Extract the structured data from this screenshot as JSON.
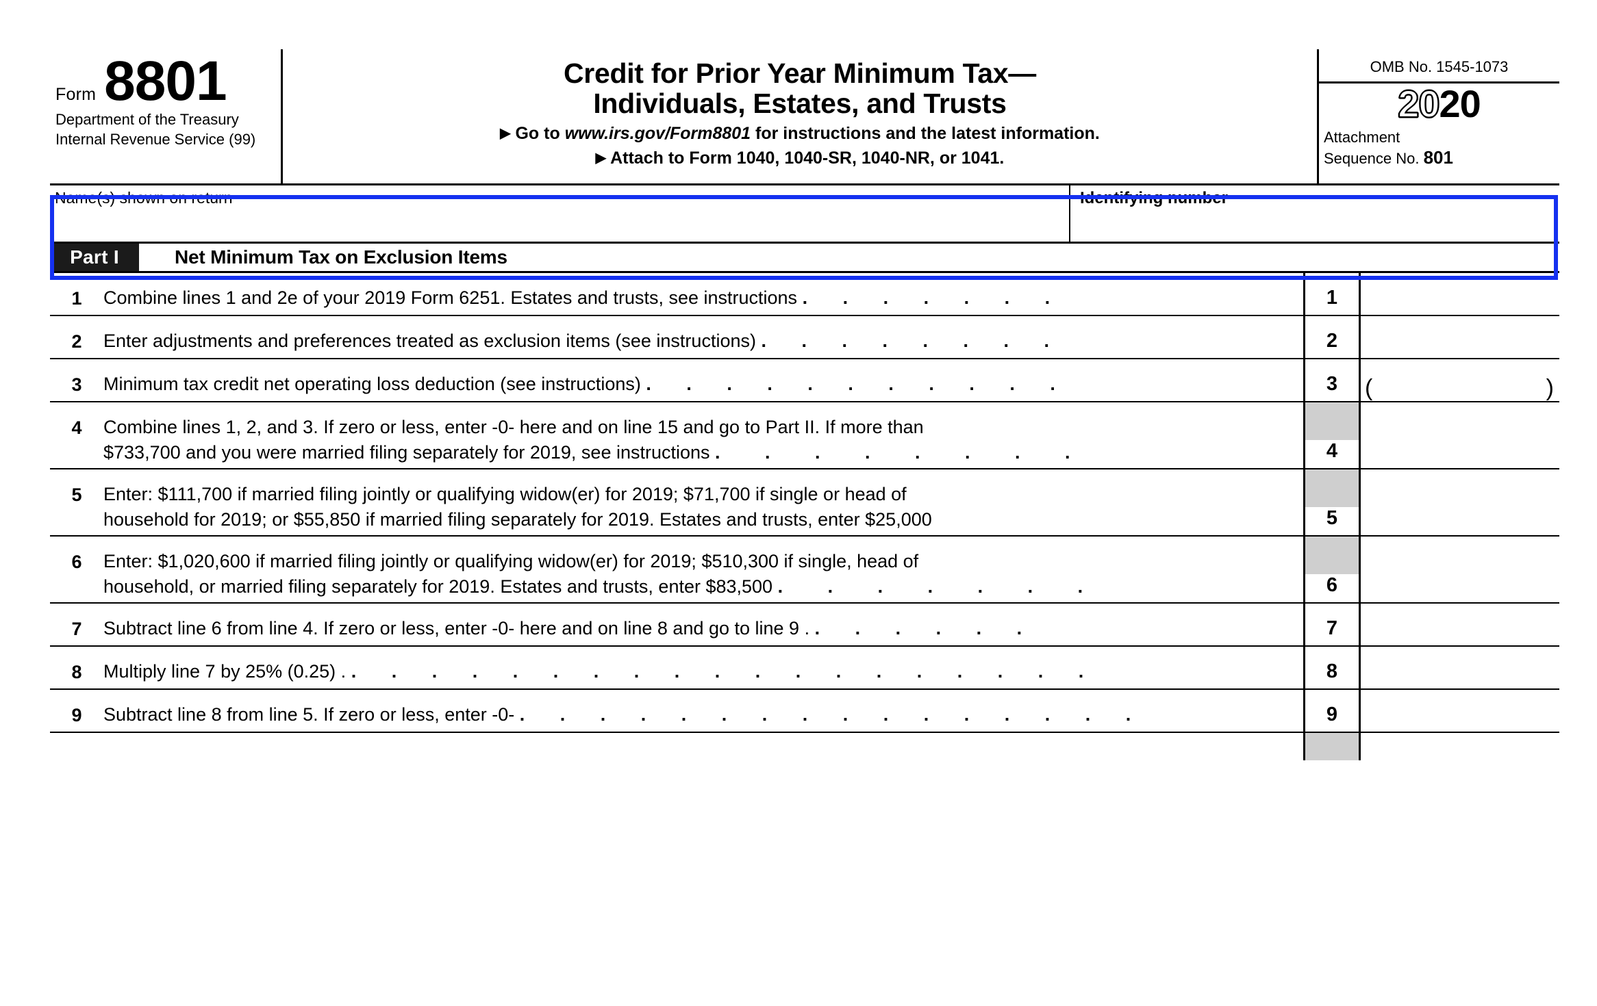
{
  "form": {
    "form_label": "Form",
    "form_number": "8801",
    "department_line1": "Department of the Treasury",
    "department_line2": "Internal Revenue Service (99)",
    "title_line1": "Credit for Prior Year Minimum Tax—",
    "title_line2": "Individuals, Estates, and Trusts",
    "goto_arrow": "▶",
    "goto_prefix": "Go to ",
    "goto_url": "www.irs.gov/Form8801",
    "goto_suffix": " for instructions and the latest information.",
    "attach_arrow": "▶",
    "attach_text": "Attach to Form 1040, 1040-SR, 1040-NR, or 1041.",
    "omb": "OMB No. 1545-1073",
    "year_hollow": "20",
    "year_solid": "20",
    "attachment_label": "Attachment",
    "sequence_label": "Sequence No.",
    "sequence_number": "801"
  },
  "identity": {
    "name_label": "Name(s) shown on return",
    "name_value": "",
    "id_label": "Identifying number",
    "id_value": ""
  },
  "part": {
    "tag": "Part I",
    "title": "Net Minimum Tax on Exclusion Items"
  },
  "lines": [
    {
      "number": "1",
      "box_number": "1",
      "text_line1": "Combine lines 1 and 2e of your 2019 Form 6251. Estates and trusts, see instructions",
      "text_line2": "",
      "leader1": ".  .  .  .  .  .  .",
      "leader2": "",
      "value": "",
      "parentheses": false,
      "shaded": false,
      "tall": false
    },
    {
      "number": "2",
      "box_number": "2",
      "text_line1": "Enter adjustments and preferences treated as exclusion items (see instructions)",
      "text_line2": "",
      "leader1": ".  .  .  .  .  .  .  .",
      "leader2": "",
      "value": "",
      "parentheses": false,
      "shaded": false,
      "tall": false
    },
    {
      "number": "3",
      "box_number": "3",
      "text_line1": "Minimum tax credit net operating loss deduction (see instructions)",
      "text_line2": "",
      "leader1": ".  .  .  .  .  .  .  .  .  .  .",
      "leader2": "",
      "value": "",
      "parentheses": true,
      "shaded": false,
      "tall": false
    },
    {
      "number": "4",
      "box_number": "4",
      "text_line1": "Combine lines 1, 2, and 3. If zero or less, enter -0- here and on line 15 and go to Part II. If more than",
      "text_line2": "$733,700 and you were married filing separately for 2019, see instructions",
      "leader1": "",
      "leader2": ".  .  .  .  .  .  .  .",
      "value": "",
      "parentheses": false,
      "shaded": true,
      "tall": true
    },
    {
      "number": "5",
      "box_number": "5",
      "text_line1": "Enter: $111,700 if married filing jointly or qualifying widow(er) for 2019; $71,700 if single or head of",
      "text_line2": "household for 2019; or $55,850 if married filing separately for 2019. Estates and trusts, enter $25,000",
      "leader1": "",
      "leader2": "",
      "value": "",
      "parentheses": false,
      "shaded": true,
      "tall": true
    },
    {
      "number": "6",
      "box_number": "6",
      "text_line1": "Enter: $1,020,600 if married filing jointly or qualifying widow(er) for 2019; $510,300 if single, head of",
      "text_line2": "household, or married filing separately for 2019. Estates and trusts, enter $83,500",
      "leader1": "",
      "leader2": ".  .  .  .  .  .  .",
      "value": "",
      "parentheses": false,
      "shaded": true,
      "tall": true
    },
    {
      "number": "7",
      "box_number": "7",
      "text_line1": "Subtract line 6 from line 4. If zero or less, enter -0- here and on line 8 and go to line 9 .",
      "text_line2": "",
      "leader1": ".  .  .  .  .  .",
      "leader2": "",
      "value": "",
      "parentheses": false,
      "shaded": false,
      "tall": false
    },
    {
      "number": "8",
      "box_number": "8",
      "text_line1": "Multiply line 7 by 25% (0.25) .",
      "text_line2": "",
      "leader1": ".  .  .  .  .  .  .  .  .  .  .  .  .  .  .  .  .  .  .",
      "leader2": "",
      "value": "",
      "parentheses": false,
      "shaded": false,
      "tall": false
    },
    {
      "number": "9",
      "box_number": "9",
      "text_line1": "Subtract line 8 from line 5. If zero or less, enter -0-",
      "text_line2": "",
      "leader1": ".  .  .  .  .  .  .  .  .  .  .  .  .  .  .  .",
      "leader2": "",
      "value": "",
      "parentheses": false,
      "shaded": false,
      "tall": false
    }
  ],
  "highlight": {
    "color": "#1531f0",
    "target": "name-and-identifying-number-row"
  }
}
